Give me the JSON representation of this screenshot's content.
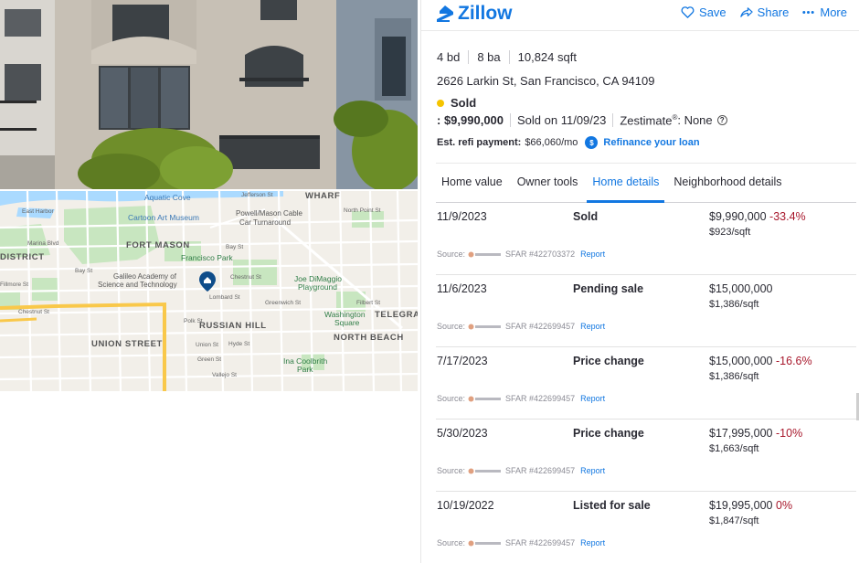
{
  "header": {
    "logo_text": "Zillow",
    "save_label": "Save",
    "share_label": "Share",
    "more_label": "More"
  },
  "property": {
    "beds": "4 bd",
    "baths": "8 ba",
    "sqft": "10,824 sqft",
    "address": "2626 Larkin St, San Francisco, CA 94109",
    "status": "Sold",
    "price": ": $9,990,000",
    "sold_on": "Sold on 11/09/23",
    "zestimate_label": "Zestimate",
    "zestimate_mark": "®",
    "zestimate_value": ": None",
    "refi_label": "Est. refi payment:",
    "refi_value": "$66,060/mo",
    "refi_link": "Refinance your loan"
  },
  "tabs": [
    {
      "label": "Home value"
    },
    {
      "label": "Owner tools"
    },
    {
      "label": "Home details"
    },
    {
      "label": "Neighborhood details"
    }
  ],
  "price_history": [
    {
      "date": "11/9/2023",
      "event": "Sold",
      "price": "$9,990,000",
      "change": "-33.4%",
      "per_sqft": "$923/sqft",
      "source": "Source:",
      "listing": "SFAR #422703372",
      "report": "Report"
    },
    {
      "date": "11/6/2023",
      "event": "Pending sale",
      "price": "$15,000,000",
      "change": "",
      "per_sqft": "$1,386/sqft",
      "source": "Source:",
      "listing": "SFAR #422699457",
      "report": "Report"
    },
    {
      "date": "7/17/2023",
      "event": "Price change",
      "price": "$15,000,000",
      "change": "-16.6%",
      "per_sqft": "$1,386/sqft",
      "source": "Source:",
      "listing": "SFAR #422699457",
      "report": "Report"
    },
    {
      "date": "5/30/2023",
      "event": "Price change",
      "price": "$17,995,000",
      "change": "-10%",
      "per_sqft": "$1,663/sqft",
      "source": "Source:",
      "listing": "SFAR #422699457",
      "report": "Report"
    },
    {
      "date": "10/19/2022",
      "event": "Listed for sale",
      "price": "$19,995,000",
      "change": "0%",
      "per_sqft": "$1,847/sqft",
      "source": "Source:",
      "listing": "SFAR #422699457",
      "report": "Report"
    }
  ],
  "map": {
    "labels": {
      "aquatic_cove": "Aquatic Cove",
      "wharf": "WHARF",
      "cartoon_art": "Cartoon Art Museum",
      "powell_mason": "Powell/Mason Cable",
      "car_turnaround": "Car Turnaround",
      "fort_mason": "FORT MASON",
      "francisco_park": "Francisco Park",
      "galileo1": "Galileo Academy of",
      "galileo2": "Science and Technology",
      "joe1": "Joe DiMaggio",
      "joe2": "Playground",
      "district": "DISTRICT",
      "marina_blvd": "Marina Blvd",
      "bay_st_w": "Bay St",
      "bay_st_e": "Bay St",
      "russian_hill": "RUSSIAN HILL",
      "telegraph": "TELEGRA",
      "washington1": "Washington",
      "washington2": "Square",
      "north_beach": "NORTH BEACH",
      "union_street": "UNION STREET",
      "ina1": "Ina Coolbrith",
      "ina2": "Park",
      "polk": "Polk St",
      "hyde": "Hyde St",
      "filmore": "Fillmore St",
      "lombard": "Lombard St",
      "greenwich": "Greenwich St",
      "union_st": "Union St",
      "green_st": "Green St",
      "vallejo": "Vallejo St",
      "chestnut": "Chestnut St",
      "filbert": "Filbert St",
      "jefferson": "Jefferson St",
      "north_point": "North Point St",
      "east_harbor": "East Harbor"
    },
    "colors": {
      "land": "#f2efe9",
      "park": "#c8e6c0",
      "water": "#aadaff",
      "highway": "#f9c84a",
      "road": "#ffffff",
      "pin": "#0f4d8a"
    }
  },
  "colors": {
    "accent": "#1277e1",
    "negative": "#a8182c",
    "sold_dot": "#f5c400"
  }
}
